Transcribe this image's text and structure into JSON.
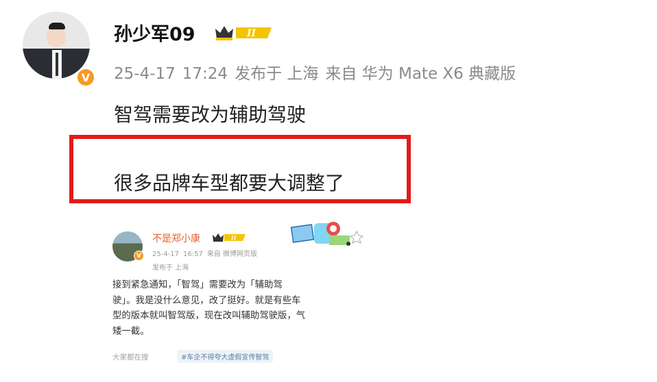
{
  "post": {
    "username": "孙少军09",
    "level_badge": "II",
    "meta": {
      "date": "25-4-17",
      "time": "17:24",
      "location": "发布于 上海",
      "device": "来自 华为 Mate X6 典藏版"
    },
    "text_line1": "智驾需要改为辅助驾驶",
    "text_line2": "很多品牌车型都要大调整了"
  },
  "embedded_post": {
    "username": "不是郑小康",
    "level_badge": "II",
    "date": "25-4-17",
    "time": "16:57",
    "source": "来自 微博网页版",
    "location": "发布于 上海",
    "body_lines": [
      "接到紧急通知，「智驾」需要改为「辅助驾",
      "驶」。我是没什么意见，改了挺好。就是有些车",
      "型的版本就叫智驾版，现在改叫辅助驾驶版，气",
      "矮一截。"
    ],
    "footer_label": "大家都在搜",
    "hashtag": "#车企不得夸大虚假宣传智驾"
  },
  "colors": {
    "highlight_box": "#e31a1a",
    "verified_badge": "#f59a23",
    "embedded_name": "#e8602c"
  },
  "icons": [
    "verified-v-icon",
    "crown-level-icon",
    "sticker-decoration-icon"
  ]
}
